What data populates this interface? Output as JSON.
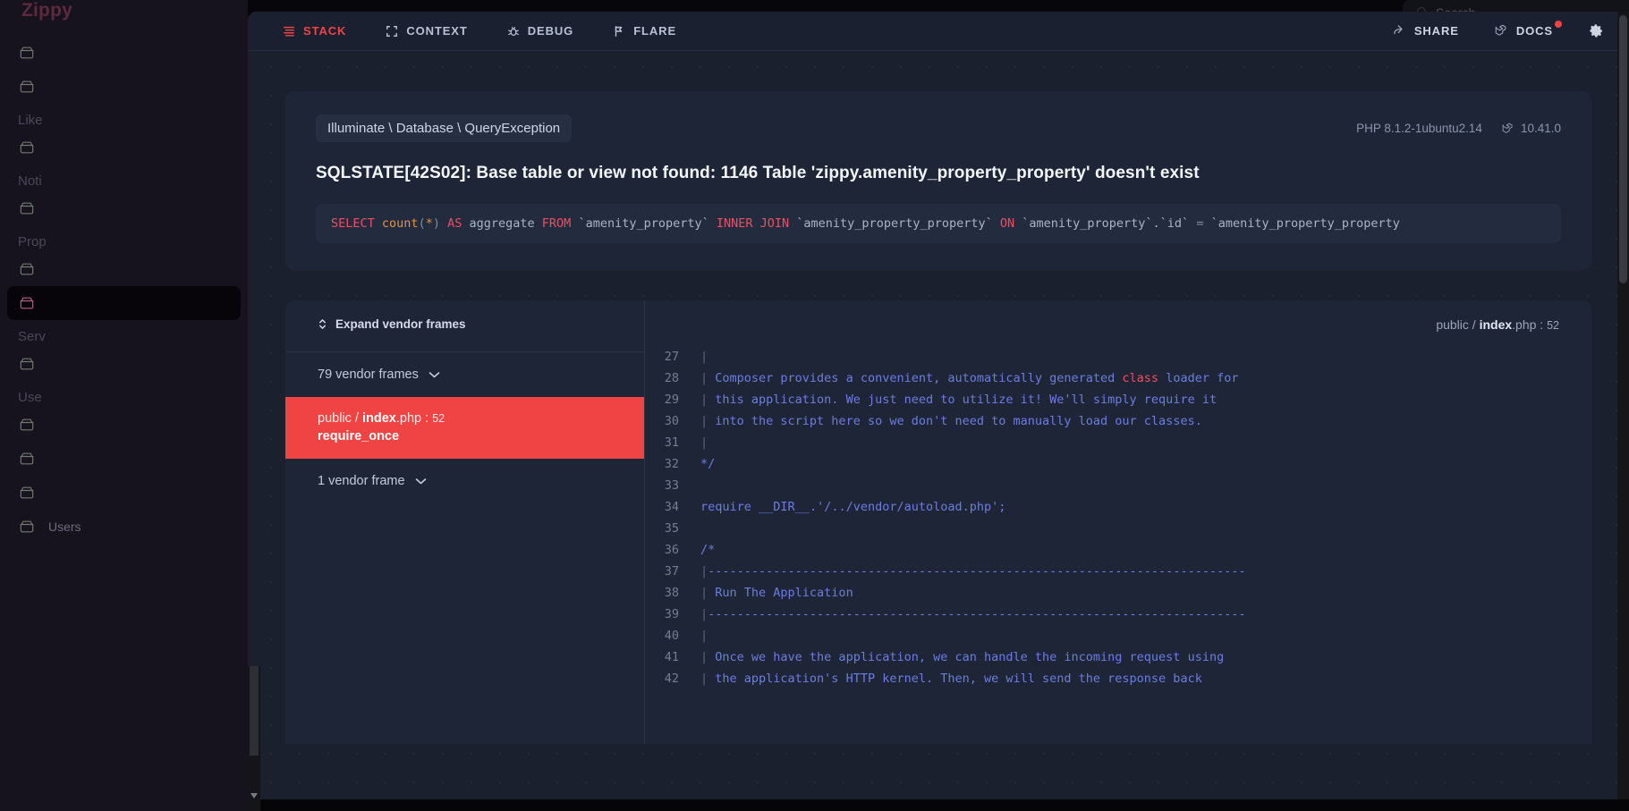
{
  "background_app": {
    "brand": "Zippy",
    "search": {
      "placeholder": "Search",
      "icon": "search-icon"
    },
    "sidebar_groups": [
      {
        "label": "",
        "items": [
          {
            "label": "",
            "icon": "box-icon",
            "active": false
          },
          {
            "label": "",
            "icon": "box-icon",
            "active": false
          }
        ]
      },
      {
        "label": "Like",
        "items": [
          {
            "label": "",
            "icon": "box-icon",
            "active": false
          }
        ]
      },
      {
        "label": "Noti",
        "items": [
          {
            "label": "",
            "icon": "box-icon",
            "active": false
          }
        ]
      },
      {
        "label": "Prop",
        "items": [
          {
            "label": "",
            "icon": "box-icon",
            "active": false
          },
          {
            "label": "",
            "icon": "box-icon",
            "active": true
          }
        ]
      },
      {
        "label": "Serv",
        "items": [
          {
            "label": "",
            "icon": "box-icon",
            "active": false
          }
        ]
      },
      {
        "label": "Use",
        "items": [
          {
            "label": "",
            "icon": "box-icon",
            "active": false
          },
          {
            "label": "",
            "icon": "box-icon",
            "active": false
          },
          {
            "label": "",
            "icon": "box-icon",
            "active": false
          },
          {
            "label": "Users",
            "icon": "box-icon",
            "active": false
          }
        ]
      }
    ]
  },
  "error_page": {
    "nav": {
      "tabs": [
        {
          "label": "STACK",
          "icon": "stack-lines-icon",
          "active": true
        },
        {
          "label": "CONTEXT",
          "icon": "crop-brackets-icon",
          "active": false
        },
        {
          "label": "DEBUG",
          "icon": "bug-icon",
          "active": false
        },
        {
          "label": "FLARE",
          "icon": "flare-flag-icon",
          "active": false
        }
      ],
      "share_label": "SHARE",
      "docs_label": "DOCS",
      "settings_icon": "gear-icon"
    },
    "exception": {
      "class": "Illuminate \\ Database \\ QueryException",
      "php_version": "PHP 8.1.2-1ubuntu2.14",
      "laravel_version": "10.41.0",
      "message": "SQLSTATE[42S02]: Base table or view not found: 1146 Table 'zippy.amenity_property_property' doesn't exist",
      "query_tokens": [
        {
          "t": "SELECT",
          "c": "k"
        },
        {
          "t": " ",
          "c": ""
        },
        {
          "t": "count",
          "c": "fn"
        },
        {
          "t": "(",
          "c": "op"
        },
        {
          "t": "*",
          "c": "fn"
        },
        {
          "t": ")",
          "c": "op"
        },
        {
          "t": " ",
          "c": ""
        },
        {
          "t": "AS",
          "c": "k"
        },
        {
          "t": " aggregate ",
          "c": ""
        },
        {
          "t": "FROM",
          "c": "k"
        },
        {
          "t": " `amenity_property` ",
          "c": ""
        },
        {
          "t": "INNER JOIN",
          "c": "k"
        },
        {
          "t": " `amenity_property_property` ",
          "c": ""
        },
        {
          "t": "ON",
          "c": "k"
        },
        {
          "t": " `amenity_property`.`id` ",
          "c": ""
        },
        {
          "t": "=",
          "c": "op"
        },
        {
          "t": " `amenity_property_property",
          "c": ""
        }
      ]
    },
    "stack": {
      "expand_label": "Expand vendor frames",
      "groups": [
        {
          "type": "collapsed",
          "label": "79 vendor frames"
        },
        {
          "type": "active",
          "path_dir": "public",
          "path_file": "index",
          "path_ext": ".php",
          "line": "52",
          "method": "require_once"
        },
        {
          "type": "collapsed",
          "label": "1 vendor frame"
        }
      ]
    },
    "code_viewer": {
      "file_dir": "public",
      "file_name": "index",
      "file_ext": ".php",
      "file_line": "52",
      "lines": [
        {
          "n": "27",
          "segs": [
            {
              "t": "|",
              "c": "pipe"
            }
          ]
        },
        {
          "n": "28",
          "segs": [
            {
              "t": "| ",
              "c": "pipe"
            },
            {
              "t": "Composer provides a convenient, automatically generated ",
              "c": "cm"
            },
            {
              "t": "class",
              "c": "kw"
            },
            {
              "t": " loader for",
              "c": "cm"
            }
          ]
        },
        {
          "n": "29",
          "segs": [
            {
              "t": "| ",
              "c": "pipe"
            },
            {
              "t": "this application. We just need to utilize it! We'll simply require it",
              "c": "cm"
            }
          ]
        },
        {
          "n": "30",
          "segs": [
            {
              "t": "| ",
              "c": "pipe"
            },
            {
              "t": "into the script here so we don't need to manually load our classes.",
              "c": "cm"
            }
          ]
        },
        {
          "n": "31",
          "segs": [
            {
              "t": "|",
              "c": "pipe"
            }
          ]
        },
        {
          "n": "32",
          "segs": [
            {
              "t": "*/",
              "c": "cm"
            }
          ]
        },
        {
          "n": "33",
          "segs": [
            {
              "t": "",
              "c": "cm"
            }
          ]
        },
        {
          "n": "34",
          "segs": [
            {
              "t": "require",
              "c": "cm"
            },
            {
              "t": " __DIR__",
              "c": "cm"
            },
            {
              "t": ".'/../vendor/autoload.php';",
              "c": "cm"
            }
          ]
        },
        {
          "n": "35",
          "segs": [
            {
              "t": "",
              "c": "cm"
            }
          ]
        },
        {
          "n": "36",
          "segs": [
            {
              "t": "/*",
              "c": "cm"
            }
          ]
        },
        {
          "n": "37",
          "segs": [
            {
              "t": "|",
              "c": "pipe"
            },
            {
              "t": "--------------------------------------------------------------------------",
              "c": "dash"
            }
          ]
        },
        {
          "n": "38",
          "segs": [
            {
              "t": "| ",
              "c": "pipe"
            },
            {
              "t": "Run The Application",
              "c": "cm"
            }
          ]
        },
        {
          "n": "39",
          "segs": [
            {
              "t": "|",
              "c": "pipe"
            },
            {
              "t": "--------------------------------------------------------------------------",
              "c": "dash"
            }
          ]
        },
        {
          "n": "40",
          "segs": [
            {
              "t": "|",
              "c": "pipe"
            }
          ]
        },
        {
          "n": "41",
          "segs": [
            {
              "t": "| ",
              "c": "pipe"
            },
            {
              "t": "Once we have the application, we can handle the incoming request using",
              "c": "cm"
            }
          ]
        },
        {
          "n": "42",
          "segs": [
            {
              "t": "| ",
              "c": "pipe"
            },
            {
              "t": "the application's HTTP kernel. Then, we will send the response back",
              "c": "cm"
            }
          ]
        }
      ]
    }
  },
  "colors": {
    "accent_red": "#ef4444",
    "frame_highlight": "#f04444",
    "panel": "#1e2537",
    "overlay_bg": "#1a202e",
    "sidebar_bg": "#16131f"
  }
}
